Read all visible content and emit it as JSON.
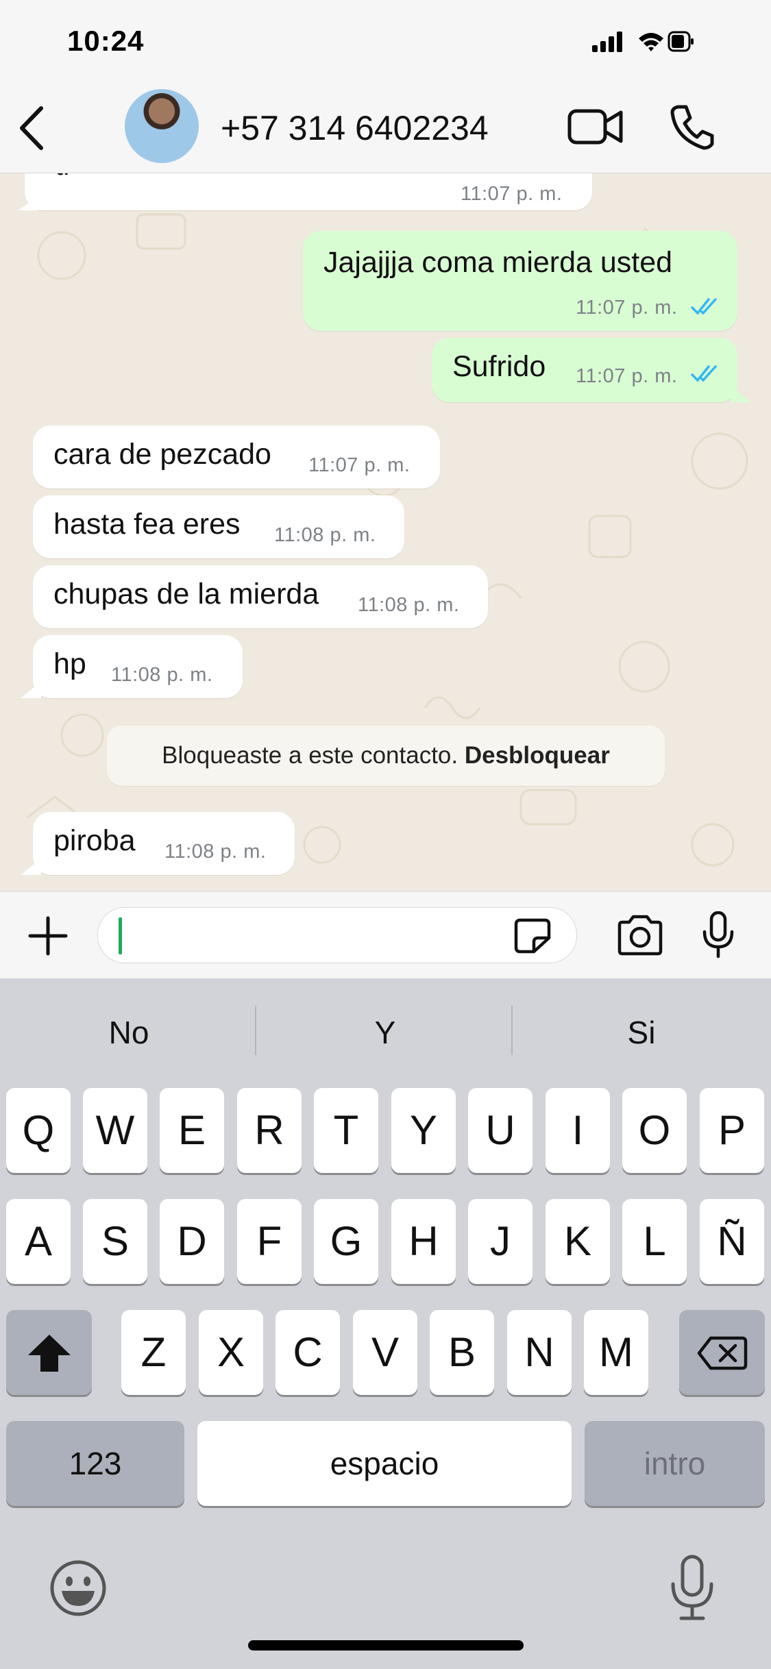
{
  "status": {
    "time": "10:24"
  },
  "header": {
    "contact": "+57 314 6402234"
  },
  "messages": [
    {
      "dir": "in",
      "text": "ti",
      "time": "11:07 p. m."
    },
    {
      "dir": "out",
      "text": "Jajajjja coma mierda usted",
      "time": "11:07 p. m."
    },
    {
      "dir": "out",
      "text": "Sufrido",
      "time": "11:07 p. m."
    },
    {
      "dir": "in",
      "text": "cara de pezcado",
      "time": "11:07 p. m."
    },
    {
      "dir": "in",
      "text": "hasta fea eres",
      "time": "11:08 p. m."
    },
    {
      "dir": "in",
      "text": "chupas de la mierda",
      "time": "11:08 p. m."
    },
    {
      "dir": "in",
      "text": "hp",
      "time": "11:08 p. m."
    },
    {
      "dir": "in",
      "text": "piroba",
      "time": "11:08 p. m."
    }
  ],
  "notice": {
    "text": "Bloqueaste a este contacto.",
    "action": "Desbloquear"
  },
  "input": {
    "value": ""
  },
  "keyboard": {
    "suggestions": [
      "No",
      "Y",
      "Si"
    ],
    "row1": [
      "Q",
      "W",
      "E",
      "R",
      "T",
      "Y",
      "U",
      "I",
      "O",
      "P"
    ],
    "row2": [
      "A",
      "S",
      "D",
      "F",
      "G",
      "H",
      "J",
      "K",
      "L",
      "Ñ"
    ],
    "row3": [
      "Z",
      "X",
      "C",
      "V",
      "B",
      "N",
      "M"
    ],
    "numbers_key": "123",
    "space_key": "espacio",
    "return_key": "intro"
  },
  "colors": {
    "outgoing_bubble": "#d9fdd3",
    "incoming_bubble": "#ffffff",
    "read_ticks": "#34b7f1",
    "caret": "#1faa59"
  },
  "icons": [
    "back-icon",
    "video-call-icon",
    "phone-icon",
    "plus-icon",
    "sticker-icon",
    "camera-icon",
    "microphone-icon",
    "shift-icon",
    "backspace-icon",
    "emoji-icon",
    "dictation-icon"
  ]
}
